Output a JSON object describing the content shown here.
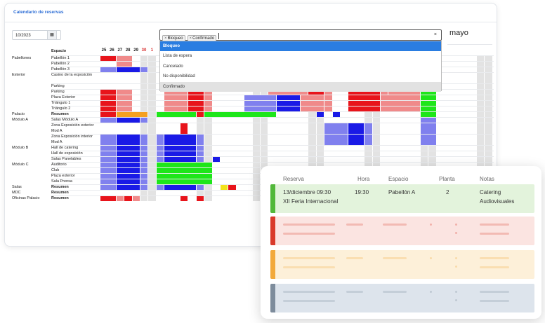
{
  "page": {
    "card_title": "Calendario de reservas"
  },
  "toolbar": {
    "date_value": "10/2023",
    "calendar_icon": "calendar-icon"
  },
  "filter": {
    "chips": [
      "Bloqueo",
      "Confirmado"
    ],
    "clear": "×",
    "chip_remove": "×"
  },
  "dropdown": {
    "options": [
      "Bloqueo",
      "Lista de espera",
      "Cancelado",
      "No disponibilidad",
      "Confirmado"
    ],
    "highlighted": "Bloqueo"
  },
  "month": "mayo",
  "grid": {
    "space_header": "Espacio",
    "days": [
      {
        "label": "25",
        "red": false
      },
      {
        "label": "26",
        "red": false
      },
      {
        "label": "27",
        "red": false
      },
      {
        "label": "28",
        "red": false
      },
      {
        "label": "29",
        "red": false
      },
      {
        "label": "30",
        "red": true
      },
      {
        "label": "1",
        "red": true
      }
    ],
    "rows": [
      {
        "group": "Pabellones",
        "space": "Pabellón 1",
        "bold": false
      },
      {
        "group": "",
        "space": "Pabellón 2",
        "bold": false
      },
      {
        "group": "",
        "space": "Pabellón 3",
        "bold": false
      },
      {
        "group": "Exterior",
        "space": "Casino de la exposición",
        "bold": false,
        "double": true
      },
      {
        "group": "",
        "space": "Parking",
        "bold": false
      },
      {
        "group": "",
        "space": "Parking",
        "bold": false
      },
      {
        "group": "",
        "space": "Plaza Exterior",
        "bold": false
      },
      {
        "group": "",
        "space": "Triángulo 1",
        "bold": false
      },
      {
        "group": "",
        "space": "Triángulo 2",
        "bold": false
      },
      {
        "group": "Palacio",
        "space": "Resumen",
        "bold": true
      },
      {
        "group": "Módulo A",
        "space": "Salas Módulo A",
        "bold": false
      },
      {
        "group": "",
        "space": "Zona Exposición exterior Mod A",
        "bold": false,
        "double": true
      },
      {
        "group": "",
        "space": "Zona Exposición interior Mod A",
        "bold": false,
        "double": true
      },
      {
        "group": "Módulo B",
        "space": "Hall de catering",
        "bold": false
      },
      {
        "group": "",
        "space": "Hall de exposición",
        "bold": false
      },
      {
        "group": "",
        "space": "Salas Panelables",
        "bold": false
      },
      {
        "group": "Módulo C",
        "space": "Auditorio",
        "bold": false
      },
      {
        "group": "",
        "space": "Club",
        "bold": false
      },
      {
        "group": "",
        "space": "Plaza exterior",
        "bold": false
      },
      {
        "group": "",
        "space": "Sala Prensa",
        "bold": false
      },
      {
        "group": "Salas",
        "space": "Resumen",
        "bold": true
      },
      {
        "group": "MDC",
        "space": "Resumen",
        "bold": true
      },
      {
        "group": "Oficinas Palacio",
        "space": "Resumen",
        "bold": true
      }
    ]
  },
  "colors": {
    "red": "#e8141b",
    "pink": "#f08a8a",
    "lavender": "#8080ee",
    "blue": "#1a1ae6",
    "green": "#1ee61a",
    "orange": "#f5a020",
    "yellow": "#f2e21a",
    "grey": "#e3e3e3"
  },
  "reservation_card": {
    "headers": [
      "Reserva",
      "Hora",
      "Espacio",
      "Planta",
      "Notas"
    ],
    "row": {
      "reserva_line1": "13/diciembre 09:30",
      "reserva_line2": "XII Feria Internacional",
      "hora": "19:30",
      "espacio": "Pabellón A",
      "planta": "2",
      "notas_line1": "Catering",
      "notas_line2": "Audiovisuales"
    },
    "row_colors": [
      {
        "accent": "#52b83a",
        "bg": "#e3f3dc"
      },
      {
        "accent": "#d93a2b",
        "bg": "#fbe4e1"
      },
      {
        "accent": "#f2a93b",
        "bg": "#fdf0d9"
      },
      {
        "accent": "#7d8c9c",
        "bg": "#dde4ec"
      }
    ]
  }
}
